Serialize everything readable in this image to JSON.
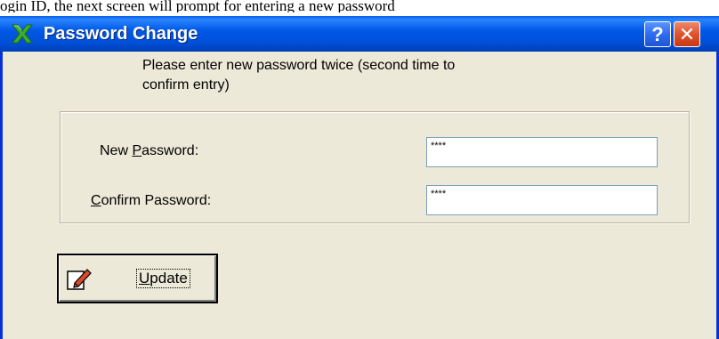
{
  "doc_line": "ogin ID, the next screen will prompt for entering a new password",
  "window": {
    "title": "Password Change",
    "title_icon": "green-x-icon",
    "help_glyph": "?",
    "close_glyph": "✕"
  },
  "instruction": {
    "line1": "Please enter new password twice (second time to",
    "line2": "confirm entry)"
  },
  "fields": {
    "new_password": {
      "label_pre": "New ",
      "label_key": "P",
      "label_post": "assword:",
      "value": "****"
    },
    "confirm_password": {
      "label_pre": "",
      "label_key": "C",
      "label_post": "onfirm Password:",
      "value": "****"
    }
  },
  "update_button": {
    "icon": "edit-document-icon",
    "label_key": "U",
    "label_rest": "pdate"
  },
  "colors": {
    "titlebar": "#0058e6",
    "window_face": "#ece9d8",
    "close_button": "#e0512c",
    "help_button": "#2f6cf0"
  }
}
